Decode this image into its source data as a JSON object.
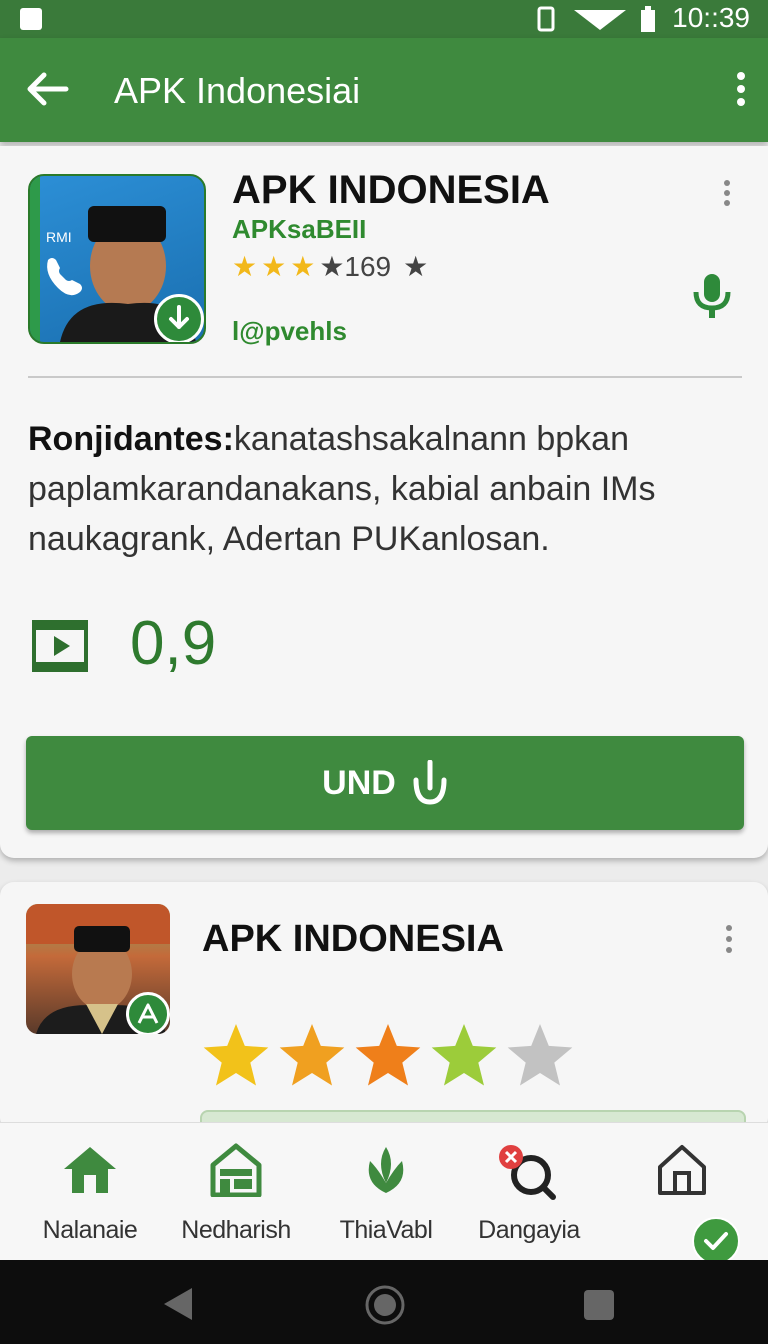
{
  "status_bar": {
    "time": "10::39"
  },
  "app_bar": {
    "title": "APK Indonesiai"
  },
  "card1": {
    "title": "APK INDONESIA",
    "developer": "APKsaBEII",
    "rating_text": "★169",
    "rating_stars": 3,
    "tag": "l@pvehls",
    "desc_bold": "Ronjidantes:",
    "desc_text": "kanatashsakalnann bpkan paplamkarandanakans, kabial anbain IMs naukagrank, Adertan PUKanlosan.",
    "stat_value": "0,9",
    "button_label": "UND"
  },
  "card2": {
    "title": "APK INDONESIA",
    "stars": [
      "#f2c21a",
      "#f0a020",
      "#ef7f1a",
      "#9ccc3a",
      "#c2c2c2"
    ]
  },
  "bottom_nav": {
    "items": [
      {
        "label": "Nalanaie",
        "icon": "home-icon"
      },
      {
        "label": "Nedharish",
        "icon": "store-icon"
      },
      {
        "label": "ThiaVabl",
        "icon": "leaf-icon"
      },
      {
        "label": "Dangayia",
        "icon": "search-icon"
      },
      {
        "label": "",
        "icon": "home-outline-icon"
      }
    ]
  },
  "colors": {
    "primary": "#3f8a3f",
    "status_bar": "#3a7a3a",
    "nav_bar": "#0d0d0d"
  }
}
